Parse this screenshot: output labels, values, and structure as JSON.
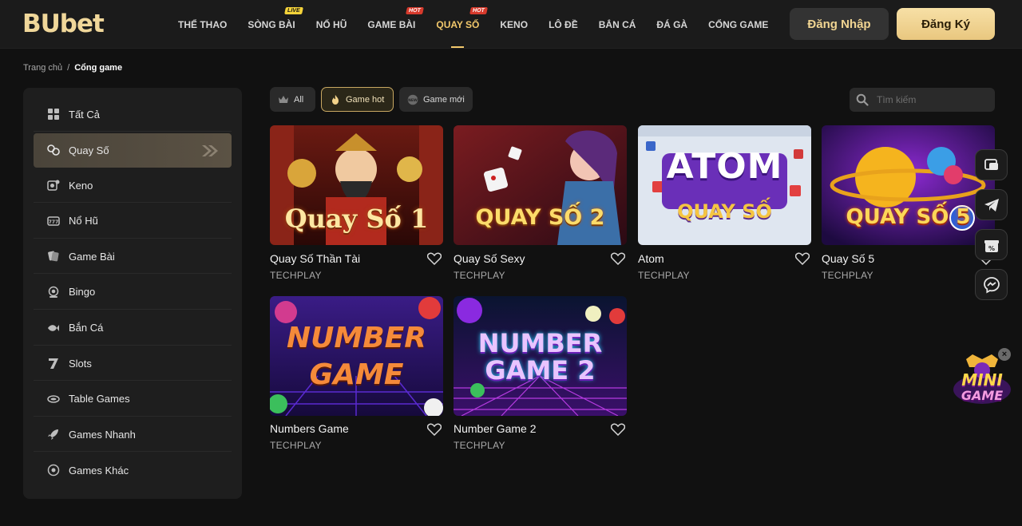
{
  "brand": {
    "logo_text": "BUbet"
  },
  "nav": {
    "items": [
      {
        "label": "THỂ THAO",
        "badge": ""
      },
      {
        "label": "SÒNG BÀI",
        "badge": "LIVE"
      },
      {
        "label": "NỔ HŨ",
        "badge": ""
      },
      {
        "label": "GAME BÀI",
        "badge": "HOT"
      },
      {
        "label": "QUAY SỐ",
        "badge": "HOT"
      },
      {
        "label": "KENO",
        "badge": ""
      },
      {
        "label": "LÔ ĐỀ",
        "badge": ""
      },
      {
        "label": "BẮN CÁ",
        "badge": ""
      },
      {
        "label": "ĐÁ GÀ",
        "badge": ""
      },
      {
        "label": "CỔNG GAME",
        "badge": ""
      }
    ],
    "active": "QUAY SỐ"
  },
  "auth": {
    "login_label": "Đăng Nhập",
    "register_label": "Đăng Ký"
  },
  "breadcrumb": {
    "home": "Trang chủ",
    "separator": "/",
    "current": "Cổng game"
  },
  "sidebar": {
    "items": [
      {
        "label": "Tất Cả",
        "icon": "grid-icon"
      },
      {
        "label": "Quay Số",
        "icon": "lottery-balls-icon"
      },
      {
        "label": "Keno",
        "icon": "keno-icon"
      },
      {
        "label": "Nổ Hũ",
        "icon": "slot-machine-icon"
      },
      {
        "label": "Game Bài",
        "icon": "cards-icon"
      },
      {
        "label": "Bingo",
        "icon": "bingo-icon"
      },
      {
        "label": "Bắn Cá",
        "icon": "fish-icon"
      },
      {
        "label": "Slots",
        "icon": "seven-icon"
      },
      {
        "label": "Table Games",
        "icon": "table-icon"
      },
      {
        "label": "Games Nhanh",
        "icon": "rocket-icon"
      },
      {
        "label": "Games Khác",
        "icon": "target-icon"
      }
    ],
    "active": "Quay Số"
  },
  "filters": [
    {
      "label": "All",
      "icon": "crown-icon"
    },
    {
      "label": "Game hot",
      "icon": "fire-icon"
    },
    {
      "label": "Game mới",
      "icon": "new-badge-icon"
    }
  ],
  "active_filter": "Game hot",
  "search": {
    "placeholder": "Tìm kiếm",
    "value": ""
  },
  "games": [
    {
      "name": "Quay Số Thần Tài",
      "provider": "TECHPLAY",
      "thumb_text": "Quay Số 1"
    },
    {
      "name": "Quay Số Sexy",
      "provider": "TECHPLAY",
      "thumb_text": "QUAY SỐ 2"
    },
    {
      "name": "Atom",
      "provider": "TECHPLAY",
      "thumb_text": "ATOM",
      "thumb_sub": "QUAY SỐ"
    },
    {
      "name": "Quay Số 5",
      "provider": "TECHPLAY",
      "thumb_text": "QUAY SỐ 5"
    },
    {
      "name": "Numbers Game",
      "provider": "TECHPLAY",
      "thumb_text": "NUMBER",
      "thumb_sub": "GAME"
    },
    {
      "name": "Number Game 2",
      "provider": "TECHPLAY",
      "thumb_text": "NUMBER",
      "thumb_sub": "GAME 2"
    }
  ],
  "floating": [
    {
      "icon": "support-chat-icon"
    },
    {
      "icon": "telegram-icon"
    },
    {
      "icon": "gift-promo-icon"
    },
    {
      "icon": "messenger-icon"
    }
  ],
  "mini_game": {
    "label_top": "MINI",
    "label_bottom": "GAME",
    "close": "×"
  },
  "colors": {
    "accent": "#f2c86b",
    "background": "#111111",
    "panel": "#1e1e1e"
  }
}
